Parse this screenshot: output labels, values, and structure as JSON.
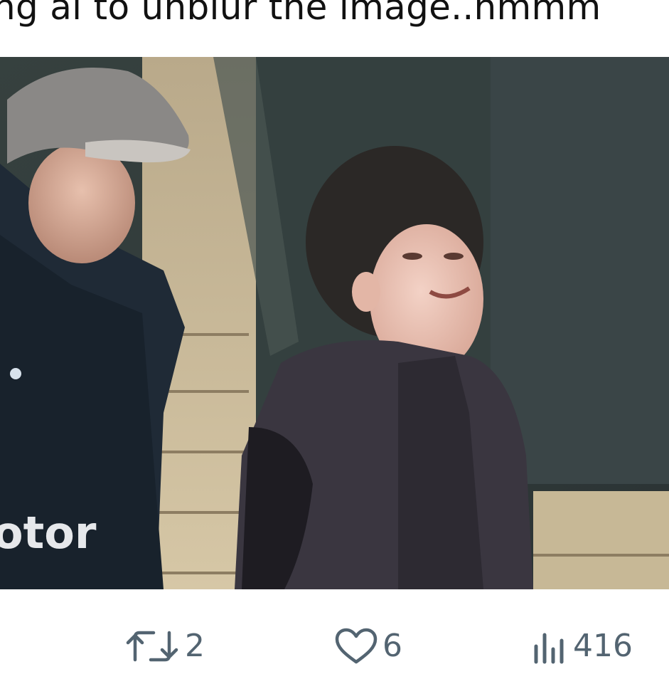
{
  "post": {
    "text": "ng ai to unblur the image..hmmm"
  },
  "media": {
    "alt_visible_text": "otor"
  },
  "actions": {
    "retweets": "2",
    "likes": "6",
    "views": "416"
  },
  "icons": {
    "retweet": "retweet-icon",
    "like": "heart-icon",
    "views": "bar-chart-icon"
  },
  "colors": {
    "icon_gray": "#536471",
    "text": "#111111",
    "background": "#ffffff"
  }
}
